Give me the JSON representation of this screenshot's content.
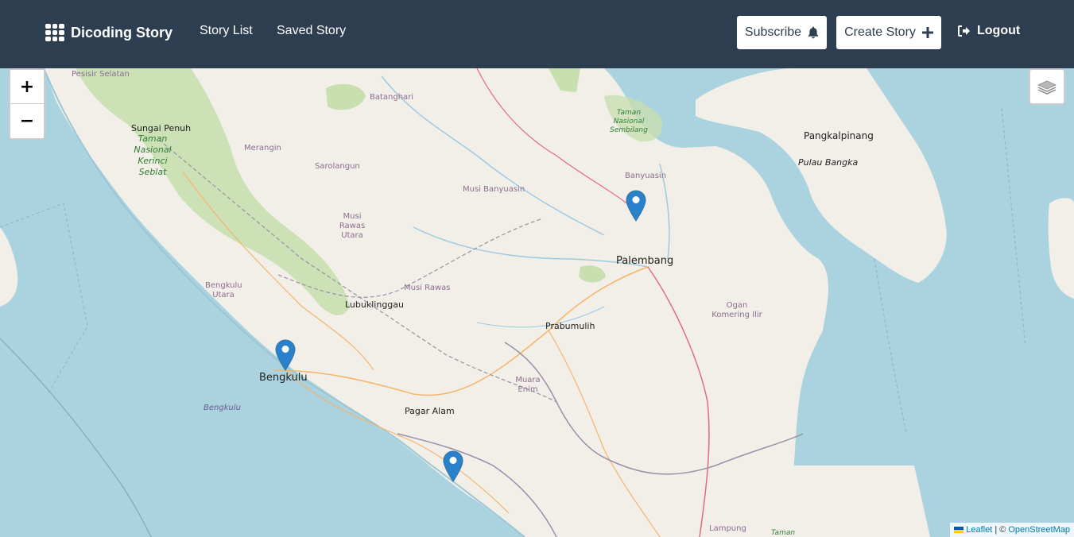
{
  "header": {
    "brand_label": "Dicoding Story",
    "nav": {
      "story_list": "Story List",
      "saved_story": "Saved Story"
    },
    "subscribe_label": "Subscribe",
    "create_story_label": "Create Story",
    "logout_label": "Logout",
    "icons": {
      "brand": "grid-icon",
      "subscribe": "bell-icon",
      "create": "plus-icon",
      "logout": "logout-icon"
    }
  },
  "map": {
    "controls": {
      "zoom_in": "+",
      "zoom_out": "−",
      "layers_icon": "layers-icon"
    },
    "labels": {
      "pesisir_selatan": "Pesisir Selatan",
      "sungai_penuh": "Sungai Penuh",
      "taman_kerinci": "Taman Nasional Kerinci Seblat",
      "merangin": "Merangin",
      "batanghari": "Batanghari",
      "sarolangun": "Sarolangun",
      "musi_banyuasin": "Musi Banyuasin",
      "taman_sembilang": "Taman Nasional Sembilang",
      "banyuasin": "Banyuasin",
      "pangkalpinang": "Pangkalpinang",
      "pulau_bangka": "Pulau Bangka",
      "musi_rawas_utara": "Musi Rawas Utara",
      "palembang": "Palembang",
      "bengkulu_utara": "Bengkulu Utara",
      "musi_rawas": "Musi Rawas",
      "lubuklinggau": "Lubuklinggau",
      "ogan_komering_ilir": "Ogan Komering Ilir",
      "prabumulih": "Prabumulih",
      "bengkulu": "Bengkulu",
      "muara_enim": "Muara Enim",
      "bengkulu_sea": "Bengkulu",
      "pagar_alam": "Pagar Alam",
      "lampung": "Lampung",
      "taman_bottom": "Taman"
    },
    "markers": [
      "map-marker",
      "map-marker",
      "map-marker"
    ],
    "attribution": {
      "leaflet": "Leaflet",
      "separator": "| ©",
      "osm": "OpenStreetMap"
    }
  },
  "colors": {
    "navbar": "#2d3e50",
    "sea": "#aad3df",
    "land": "#f2efe9",
    "park": "#c8dfb0",
    "marker": "#2a81cb"
  }
}
